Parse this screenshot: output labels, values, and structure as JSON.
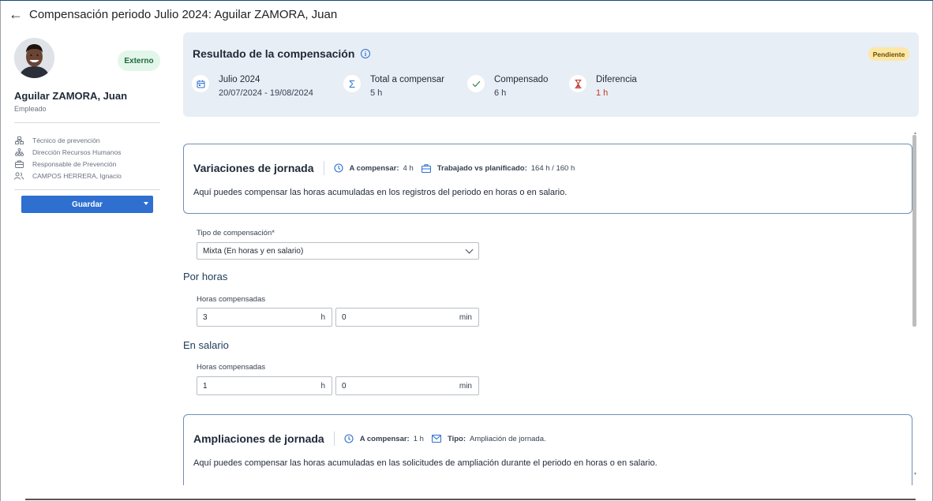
{
  "header": {
    "title": "Compensación periodo Julio 2024: Aguilar ZAMORA, Juan"
  },
  "profile": {
    "badge": "Externo",
    "name": "Aguilar ZAMORA, Juan",
    "role": "Empleado",
    "details": [
      {
        "icon": "org-chart-icon",
        "text": "Técnico de prevención"
      },
      {
        "icon": "hierarchy-icon",
        "text": "Dirección Recursos Humanos"
      },
      {
        "icon": "briefcase-icon",
        "text": "Responsable de Prevención"
      },
      {
        "icon": "user-group-icon",
        "text": "CAMPOS HERRERA, Ignacio"
      }
    ],
    "save_label": "Guardar"
  },
  "result": {
    "title": "Resultado de la compensación",
    "status": "Pendiente",
    "stats": [
      {
        "icon": "calendar-icon",
        "label": "Julio 2024",
        "value": "20/07/2024 - 19/08/2024"
      },
      {
        "icon": "sum-icon",
        "label": "Total a compensar",
        "value": "5 h"
      },
      {
        "icon": "check-icon",
        "label": "Compensado",
        "value": "6 h"
      },
      {
        "icon": "hourglass-icon",
        "label": "Diferencia",
        "value": "1 h"
      }
    ],
    "colors": {
      "difference": "#c0392b",
      "pending_bg": "#fde7a7",
      "card_bg": "#e8eef5"
    }
  },
  "variaciones": {
    "title": "Variaciones de jornada",
    "a_compensar_label": "A compensar:",
    "a_compensar_value": "4 h",
    "trabajado_label": "Trabajado vs planificado:",
    "trabajado_value": "164 h / 160 h",
    "description": "Aquí puedes compensar las horas acumuladas en los registros del periodo en horas o en salario."
  },
  "form": {
    "tipo_label": "Tipo de compensación*",
    "tipo_value": "Mixta (En horas y en salario)",
    "por_horas": {
      "title": "Por horas",
      "label": "Horas compensadas",
      "hours": "3",
      "hours_unit": "h",
      "minutes": "0",
      "minutes_unit": "min"
    },
    "en_salario": {
      "title": "En salario",
      "label": "Horas compensadas",
      "hours": "1",
      "hours_unit": "h",
      "minutes": "0",
      "minutes_unit": "min"
    }
  },
  "ampliaciones": {
    "title": "Ampliaciones de jornada",
    "a_compensar_label": "A compensar:",
    "a_compensar_value": "1 h",
    "tipo_label": "Tipo:",
    "tipo_value": "Ampliación de jornada.",
    "description": "Aquí puedes compensar las horas acumuladas en las solicitudes de ampliación durante el periodo en horas o en salario."
  }
}
